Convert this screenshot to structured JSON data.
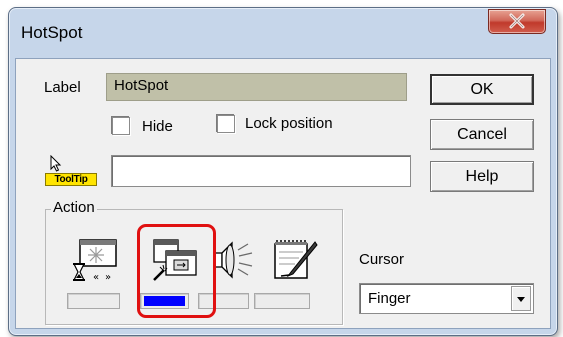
{
  "window": {
    "title": "HotSpot"
  },
  "form": {
    "label_caption": "Label",
    "label_value": "HotSpot",
    "hide_label": "Hide",
    "hide_checked": false,
    "lock_label": "Lock position",
    "lock_checked": false,
    "tooltip_badge": "ToolTip",
    "tooltip_value": ""
  },
  "buttons": {
    "ok": "OK",
    "cancel": "Cancel",
    "help": "Help"
  },
  "action": {
    "group_title": "Action",
    "items": [
      {
        "icon": "hourglass-transition-icon",
        "selected": false
      },
      {
        "icon": "page-navigation-icon",
        "selected": true
      },
      {
        "icon": "speaker-sound-icon",
        "selected": false
      },
      {
        "icon": "notepad-pen-icon",
        "selected": false
      }
    ],
    "selected_color": "#0000ff",
    "highlight_color": "#e01010"
  },
  "cursor": {
    "label": "Cursor",
    "value": "Finger"
  }
}
